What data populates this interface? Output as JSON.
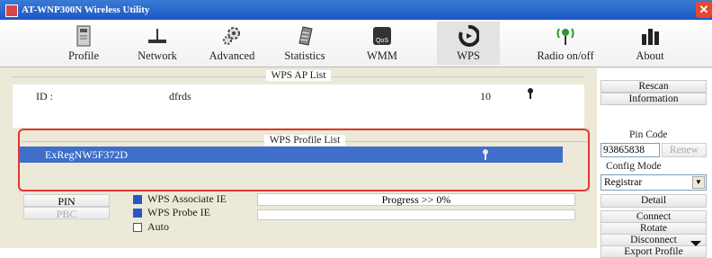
{
  "window": {
    "title": "AT-WNP300N Wireless Utility"
  },
  "toolbar": {
    "items": [
      {
        "label": "Profile",
        "icon": "profile-icon"
      },
      {
        "label": "Network",
        "icon": "network-icon"
      },
      {
        "label": "Advanced",
        "icon": "gears-icon"
      },
      {
        "label": "Statistics",
        "icon": "statistics-icon"
      },
      {
        "label": "WMM",
        "icon": "wmm-qos-icon"
      },
      {
        "label": "WPS",
        "icon": "wps-icon"
      },
      {
        "label": "Radio on/off",
        "icon": "radio-icon"
      },
      {
        "label": "About",
        "icon": "about-icon"
      }
    ],
    "active": "WPS"
  },
  "wps_ap_list": {
    "heading": "WPS AP List",
    "row": {
      "id_label": "ID :",
      "ssid": "dfrds",
      "channel": "10"
    }
  },
  "wps_profile_list": {
    "heading": "WPS Profile List",
    "selected": "ExRegNW5F372D"
  },
  "right_pane": {
    "rescan": "Rescan",
    "information": "Information",
    "pin_code_label": "Pin Code",
    "pin_code_value": "93865838",
    "renew": "Renew",
    "config_mode_label": "Config Mode",
    "config_mode_value": "Registrar",
    "detail": "Detail",
    "connect": "Connect",
    "rotate": "Rotate",
    "disconnect": "Disconnect",
    "export_profile": "Export Profile"
  },
  "bottom": {
    "pin_button": "PIN",
    "pbc_button": "PBC",
    "wps_associate_ie": "WPS Associate IE",
    "wps_probe_ie": "WPS Probe IE",
    "auto": "Auto",
    "progress_text": "Progress >> 0%"
  },
  "colors": {
    "selection": "#3f6fc8",
    "highlight_border": "#e23737",
    "title_bar": "#1c57c4"
  }
}
